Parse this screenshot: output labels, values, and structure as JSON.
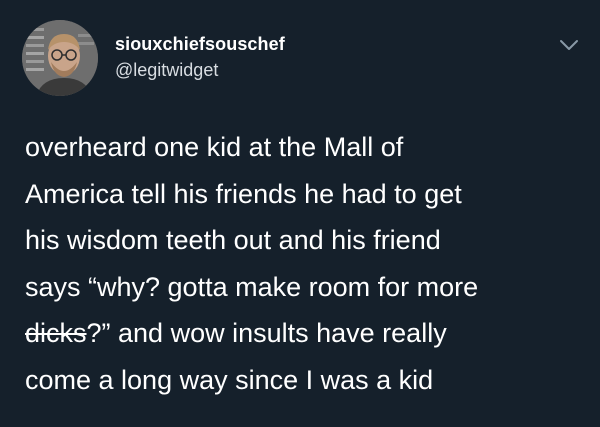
{
  "author": {
    "display_name": "siouxchiefsouschef",
    "handle": "@legitwidget"
  },
  "icons": {
    "avatar": "avatar-photo",
    "menu": "chevron-down-icon"
  },
  "tweet": {
    "lines": [
      "overheard one kid at the Mall of",
      "America tell his friends he had to get",
      "his wisdom teeth out and his friend",
      "says “why? gotta make room for more"
    ],
    "line5_struck": "dicks",
    "line5_rest": "?” and wow insults have really",
    "line6": "come a long way since I was a kid"
  },
  "colors": {
    "background": "#15202b",
    "text": "#ffffff",
    "handle": "#d8dde2",
    "chevron": "#8899a6"
  }
}
